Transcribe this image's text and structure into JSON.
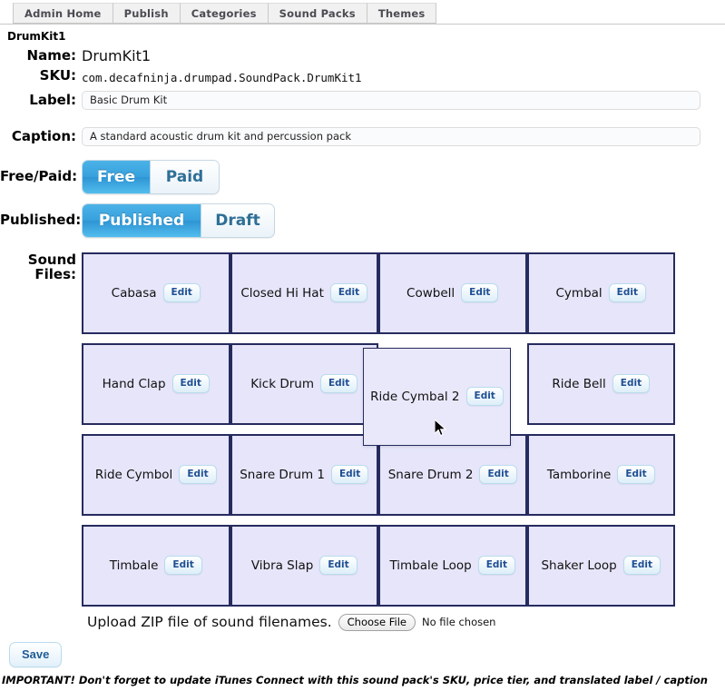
{
  "tabs": [
    {
      "label": "Admin Home"
    },
    {
      "label": "Publish"
    },
    {
      "label": "Categories"
    },
    {
      "label": "Sound Packs"
    },
    {
      "label": "Themes"
    }
  ],
  "page": {
    "title": "DrumKit1"
  },
  "form": {
    "name_label": "Name:",
    "name_value": "DrumKit1",
    "sku_label": "SKU:",
    "sku_value": "com.decafninja.drumpad.SoundPack.DrumKit1",
    "label_label": "Label:",
    "label_value": "Basic Drum Kit",
    "caption_label": "Caption:",
    "caption_value": "A standard acoustic drum kit and percussion pack",
    "freepaid_label": "Free/Paid:",
    "free_option": "Free",
    "paid_option": "Paid",
    "freepaid_selected": "Free",
    "published_label": "Published:",
    "published_option": "Published",
    "draft_option": "Draft",
    "published_selected": "Published",
    "sound_files_label": "Sound Files:"
  },
  "sound_files": {
    "edit_label": "Edit",
    "cells": [
      {
        "label": "Cabasa"
      },
      {
        "label": "Closed Hi Hat"
      },
      {
        "label": "Cowbell"
      },
      {
        "label": "Cymbal"
      },
      {
        "label": "Hand Clap"
      },
      {
        "label": "Kick Drum"
      },
      {
        "label": "",
        "empty": true
      },
      {
        "label": "Ride Bell"
      },
      {
        "label": "Ride Cymbol"
      },
      {
        "label": "Snare Drum 1"
      },
      {
        "label": "Snare Drum 2"
      },
      {
        "label": "Tamborine"
      },
      {
        "label": "Timbale"
      },
      {
        "label": "Vibra Slap"
      },
      {
        "label": "Timbale Loop"
      },
      {
        "label": "Shaker Loop"
      }
    ],
    "dragging": {
      "label": "Ride Cymbal 2"
    }
  },
  "upload": {
    "text": "Upload ZIP file of sound filenames.",
    "choose_file_label": "Choose File",
    "no_file_text": "No file chosen"
  },
  "actions": {
    "save_label": "Save"
  },
  "footnote": "IMPORTANT! Don't forget to update iTunes Connect with this sound pack's SKU, price tier, and translated label / caption",
  "colors": {
    "accent_blue": "#38a1dd",
    "cell_bg": "#e6e5fa",
    "cell_border": "#262b5e",
    "edit_text": "#1f4f93"
  }
}
